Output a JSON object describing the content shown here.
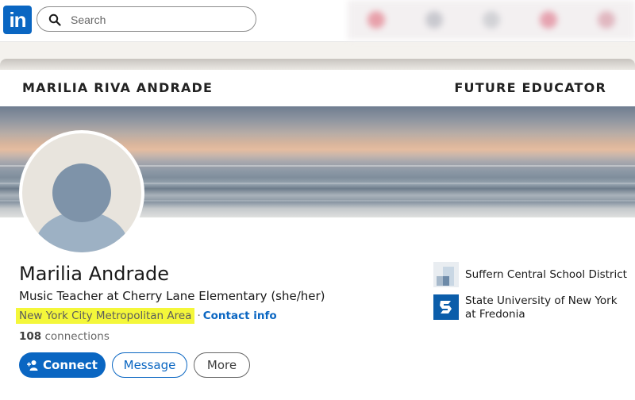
{
  "nav": {
    "logo_text": "in",
    "search_placeholder": "Search",
    "search_icon": "search-icon"
  },
  "banner": {
    "left_title": "MARILIA RIVA ANDRADE",
    "right_title": "FUTURE EDUCATOR"
  },
  "profile": {
    "name": "Marilia Andrade",
    "headline": "Music Teacher at Cherry Lane Elementary (she/her)",
    "location": "New York City Metropolitan Area",
    "separator": "·",
    "contact_label": "Contact info",
    "connections_count": "108",
    "connections_label": "connections",
    "avatar_icon": "default-avatar-icon"
  },
  "actions": {
    "connect_label": "Connect",
    "connect_icon": "add-person-icon",
    "message_label": "Message",
    "more_label": "More"
  },
  "organizations": [
    {
      "name": "Suffern Central School District",
      "icon": "company-building-icon"
    },
    {
      "name": "State University of New York at Fredonia",
      "icon": "school-logo-icon"
    }
  ],
  "colors": {
    "accent": "#0a66c2",
    "highlight": "#f4f73a"
  }
}
